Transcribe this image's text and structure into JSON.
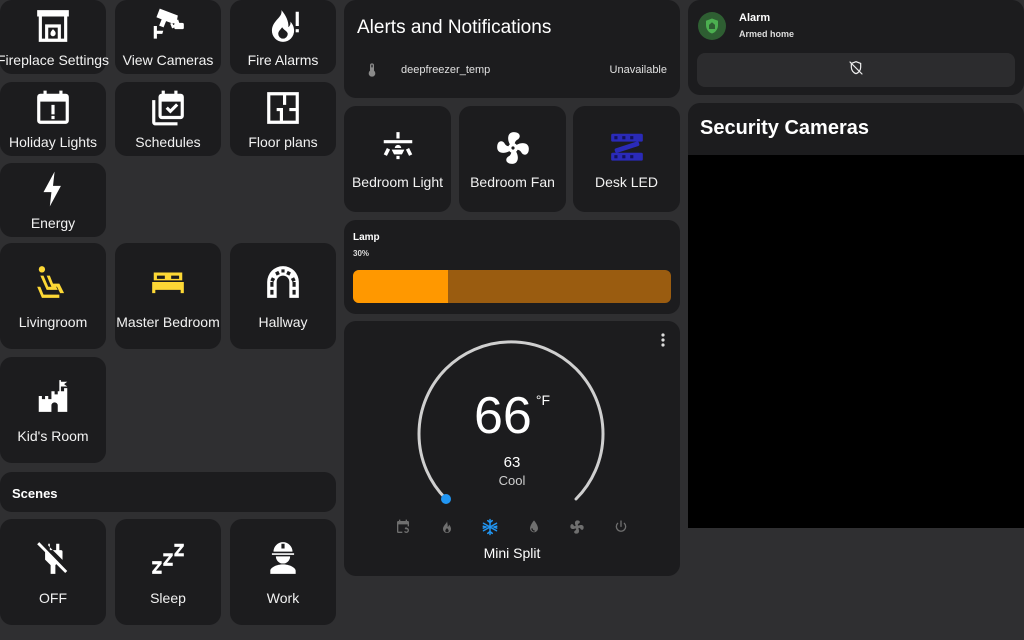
{
  "tiles": {
    "fireplace": "Fireplace Settings",
    "cameras": "View Cameras",
    "fire_alarms": "Fire Alarms",
    "holiday": "Holiday Lights",
    "schedules": "Schedules",
    "floor_plans": "Floor plans",
    "energy": "Energy"
  },
  "rooms": {
    "livingroom": "Livingroom",
    "master_bedroom": "Master Bedroom",
    "hallway": "Hallway",
    "kids_room": "Kid's Room"
  },
  "scenes": {
    "title": "Scenes",
    "off": "OFF",
    "sleep": "Sleep",
    "work": "Work"
  },
  "alerts": {
    "title": "Alerts and Notifications",
    "sensor_name": "deepfreezer_temp",
    "sensor_state": "Unavailable"
  },
  "devices": {
    "bedroom_light": "Bedroom Light",
    "bedroom_fan": "Bedroom Fan",
    "desk_led": "Desk LED"
  },
  "lamp": {
    "name": "Lamp",
    "brightness_label": "30%",
    "brightness": 0.3
  },
  "thermostat": {
    "target": "66",
    "unit": "°F",
    "current": "63",
    "mode": "Cool",
    "name": "Mini Split"
  },
  "alarm": {
    "name": "Alarm",
    "state": "Armed home"
  },
  "security": {
    "title": "Security Cameras"
  },
  "colors": {
    "background": "#2f2f31",
    "card": "#1c1c1e",
    "yellow_icon": "#fdd835",
    "lamp_on": "#ff9800",
    "lamp_off": "#9a5c10",
    "cool_mode": "#2196f3",
    "alarm_green": "#2e7d32",
    "desk_led": "#2a2ab8"
  },
  "icons": [
    "fireplace-icon",
    "cctv-icon",
    "fire-alert-icon",
    "calendar-alert-icon",
    "calendar-check-icon",
    "floor-plan-icon",
    "lightning-icon",
    "seat-recline-icon",
    "bed-icon",
    "archway-icon",
    "castle-icon",
    "power-plug-off-icon",
    "sleep-icon",
    "worker-icon",
    "thermometer-icon",
    "ceiling-fan-light-icon",
    "fan-icon",
    "led-strip-icon",
    "kebab-menu-icon",
    "calendar-sync-icon",
    "flame-icon",
    "snowflake-icon",
    "water-icon",
    "power-icon",
    "shield-home-icon",
    "shield-off-icon"
  ]
}
